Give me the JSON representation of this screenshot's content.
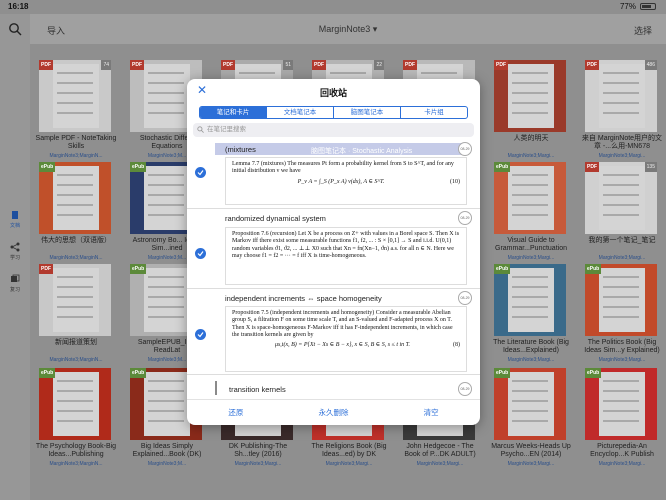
{
  "status": {
    "time": "16:18",
    "battery": "77%",
    "battery_level": 0.77
  },
  "topbar": {
    "import": "导入",
    "title": "MarginNote3 ▾",
    "select": "选择"
  },
  "sidebar": {
    "items": [
      {
        "label": "文档"
      },
      {
        "label": "学习"
      },
      {
        "label": "复习"
      }
    ]
  },
  "tiles": [
    {
      "badge": "PDF",
      "count": "74",
      "title": "Sample PDF - NoteTaking Skills",
      "sub": "MarginNote3;MarginN..."
    },
    {
      "badge": "PDF",
      "count": "",
      "title": "Stochastic Diffe... Equations",
      "sub": "MarginNote3;M..."
    },
    {
      "badge": "PDF",
      "count": "51",
      "title": "",
      "sub": ""
    },
    {
      "badge": "PDF",
      "count": "22",
      "title": "",
      "sub": ""
    },
    {
      "badge": "PDF",
      "count": "",
      "title": "",
      "sub": ""
    },
    {
      "badge": "PDF",
      "count": "",
      "title": "人类的明天",
      "sub": "MarginNote3;Margi..."
    },
    {
      "badge": "PDF",
      "count": "486",
      "title": "来自 MarginNote用户的文章 -...么用-MN678",
      "sub": "MarginNote3;Margi..."
    },
    {
      "badge": "ePub",
      "count": "",
      "title": "伟大的思想（双语版）",
      "sub": "MarginNote3;MarginN..."
    },
    {
      "badge": "ePub",
      "count": "",
      "title": "Astronomy Bo... Ideas Sim...ined",
      "sub": "MarginNote3;M..."
    },
    {
      "badge": "ePub",
      "count": "",
      "title": "Visual Guide to Grammar...Punctuation",
      "sub": "MarginNote3;Margi..."
    },
    {
      "badge": "PDF",
      "count": "135",
      "title": "我的第一个笔记_笔记",
      "sub": "MarginNote3;Margi..."
    },
    {
      "badge": "PDF",
      "count": "",
      "title": "新闻报道策划",
      "sub": "MarginNote3;MarginN..."
    },
    {
      "badge": "ePub",
      "count": "",
      "title": "SampleEPUB_In... ReadLat",
      "sub": "MarginNote3;M..."
    },
    {
      "badge": "ePub",
      "count": "",
      "title": "The Literature Book (Big Ideas...Explained)",
      "sub": "MarginNote3;Margi..."
    },
    {
      "badge": "ePub",
      "count": "",
      "title": "The Politics Book (Big Ideas Sim...y Explained)",
      "sub": "MarginNote3;Margi..."
    },
    {
      "badge": "ePub",
      "count": "",
      "title": "The Psychology Book-Big Ideas...Publishing",
      "sub": "MarginNote3;MarginN..."
    },
    {
      "badge": "ePub",
      "count": "",
      "title": "Big Ideas Simply Explained...Book (DK)",
      "sub": "MarginNote3;M..."
    },
    {
      "badge": "ePub",
      "count": "",
      "title": "DK Publishing-The Sh...tley (2016)",
      "sub": "MarginNote3;Margi..."
    },
    {
      "badge": "ePub",
      "count": "",
      "title": "The Religions Book (Big Ideas...ed) by DK",
      "sub": "MarginNote3;Margi..."
    },
    {
      "badge": "ePub",
      "count": "",
      "title": "John Hedgecoe - The Book of P...DK ADULT)",
      "sub": "MarginNote3;Margi..."
    },
    {
      "badge": "ePub",
      "count": "",
      "title": "Marcus Weeks-Heads Up Psycho...EN (2014)",
      "sub": "MarginNote3;Margi..."
    },
    {
      "badge": "ePub",
      "count": "",
      "title": "Picturepedia-An Encyclop...K Publish",
      "sub": "MarginNote3;Margi..."
    }
  ],
  "modal": {
    "close": "✕",
    "title": "回收站",
    "tabs": [
      "笔记和卡片",
      "文档笔记本",
      "脑图笔记本",
      "卡片组"
    ],
    "search_placeholder": "在笔记里搜索",
    "stamp": "脑图笔记本 · Stochastic Analysis",
    "notes": [
      {
        "head": "(mixtures",
        "date": "08-29",
        "excerpt_a": "Lemma 7.7 (mixtures) The measures Pt form a probability kernel from S to S^T, and for any initial distribution ν we have",
        "formula": "P_ν A = ∫_S (P_x A) ν(dx),   A ∈ S^T.",
        "eq": "(10)"
      },
      {
        "head": "randomized dynamical system",
        "date": "08-29",
        "excerpt_a": "Proposition 7.6 (recursion) Let X be a process on Z+ with values in a Borel space S. Then X is Markov iff there exist some measurable functions f1, f2, ... : S × [0,1] → S and i.i.d. U(0,1) random variables ϑ1, ϑ2, ... ⊥⊥ X0 such that Xn = fn(Xn−1, ϑn) a.s. for all n ∈ N. Here we may choose f1 = f2 = ··· = f iff X is time-homogeneous.",
        "formula": "",
        "eq": ""
      },
      {
        "head": "independent increments ⇔ space homogeneity",
        "date": "08-29",
        "excerpt_a": "Proposition 7.5 (independent increments and homogeneity) Consider a measurable Abelian group S, a filtration F on some time scale T, and an S-valued and F-adapted process X on T. Then X is space-homogeneous F-Markov iff it has F-independent increments, in which case the transition kernels are given by",
        "formula": "μs,t(x, B) = P{Xt − Xs ∈ B − x},   x ∈ S, B ∈ S, s ≤ t in T.",
        "eq": "(8)"
      },
      {
        "head": "transition kernels",
        "date": "08-29"
      }
    ],
    "footer": [
      "还原",
      "永久删除",
      "清空"
    ]
  },
  "colors": {
    "accent": "#2c6fd8",
    "pdf_badge": "#b23a2e",
    "epub_badge": "#5c8a3a"
  }
}
